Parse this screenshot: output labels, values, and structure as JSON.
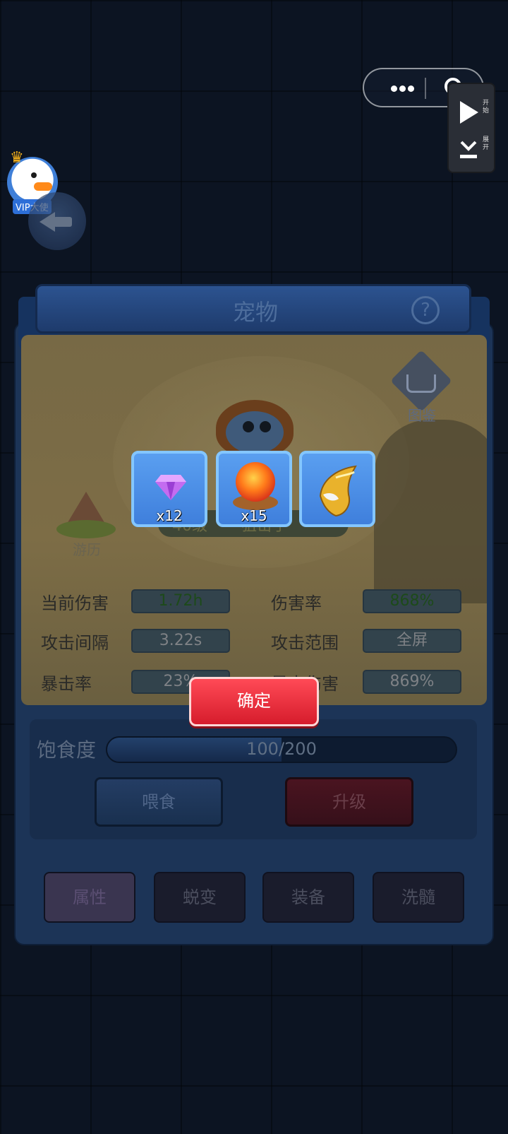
{
  "title": "宠物",
  "help": "?",
  "tujian_label": "图鉴",
  "youli_label": "游历",
  "vip_tag": "VIP大使",
  "side_panel": {
    "top_label": "开始",
    "bottom_label": "展开"
  },
  "pet": {
    "level": "40级",
    "class": "狙击手"
  },
  "stats": [
    {
      "label": "当前伤害",
      "value": "1.72h",
      "color": "green"
    },
    {
      "label": "伤害率",
      "value": "868%",
      "color": "green"
    },
    {
      "label": "攻击间隔",
      "value": "3.22s"
    },
    {
      "label": "攻击范围",
      "value": "全屏"
    },
    {
      "label": "暴击率",
      "value": "23%"
    },
    {
      "label": "暴击伤害",
      "value": "869%"
    }
  ],
  "satiety": {
    "label": "饱食度",
    "value": "100/200",
    "fraction": 0.5
  },
  "buttons": {
    "feed": "喂食",
    "upgrade": "升级",
    "confirm": "确定"
  },
  "tabs": [
    "属性",
    "蜕变",
    "装备",
    "洗髓"
  ],
  "rewards": [
    {
      "icon": "purple-gem-icon",
      "qty": "x12"
    },
    {
      "icon": "fire-orb-icon",
      "qty": "x15"
    },
    {
      "icon": "golden-eagle-helmet-icon",
      "qty": ""
    }
  ],
  "colors": {
    "confirm": "#e52a38",
    "reward_bg": "#4a8fe8",
    "panel": "#1c3457"
  }
}
